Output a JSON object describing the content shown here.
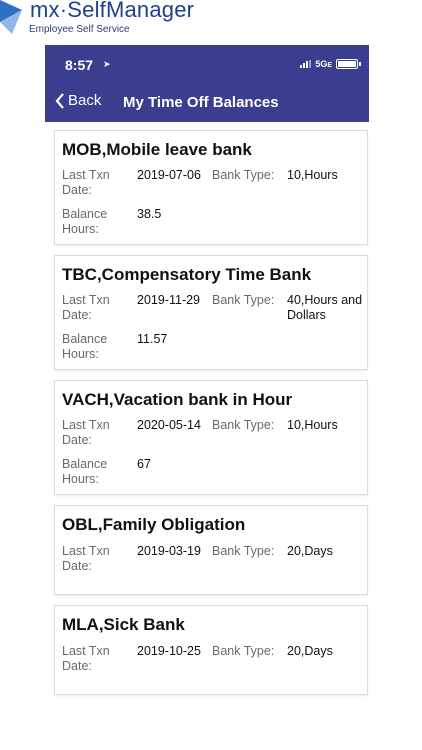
{
  "brand": {
    "name_prefix": "mx",
    "name_dot": "·",
    "name_main": "SelfManager",
    "subtitle": "Employee  Self Service"
  },
  "status_bar": {
    "time": "8:57",
    "network": "5G",
    "network_suffix": "E"
  },
  "nav": {
    "back_label": "Back",
    "title": "My Time Off Balances"
  },
  "labels": {
    "last_txn": "Last Txn Date:",
    "bank_type": "Bank Type:",
    "balance": "Balance Hours:"
  },
  "banks": [
    {
      "title": "MOB,Mobile leave bank",
      "last_txn_date": "2019-07-06",
      "bank_type": "10,Hours",
      "balance_hours": "38.5"
    },
    {
      "title": "TBC,Compensatory Time Bank",
      "last_txn_date": "2019-11-29",
      "bank_type": "40,Hours and Dollars",
      "balance_hours": "11.57"
    },
    {
      "title": "VACH,Vacation bank in Hour",
      "last_txn_date": "2020-05-14",
      "bank_type": "10,Hours",
      "balance_hours": "67"
    },
    {
      "title": "OBL,Family Obligation",
      "last_txn_date": "2019-03-19",
      "bank_type": "20,Days"
    },
    {
      "title": "MLA,Sick Bank",
      "last_txn_date": "2019-10-25",
      "bank_type": "20,Days"
    }
  ]
}
